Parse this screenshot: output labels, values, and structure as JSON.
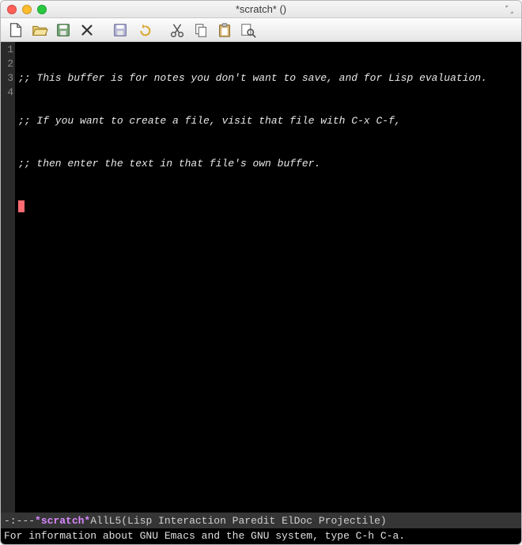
{
  "window": {
    "title": "*scratch* ()"
  },
  "toolbar": {
    "new_file": "new-file",
    "open_file": "open-file",
    "save_file": "save-file",
    "close": "close",
    "save_all": "save-all",
    "undo": "undo",
    "cut": "cut",
    "copy": "copy",
    "paste": "paste",
    "search": "search"
  },
  "gutter": {
    "lines": [
      "1",
      "2",
      "3",
      "4"
    ]
  },
  "buffer": {
    "lines": [
      ";; This buffer is for notes you don't want to save, and for Lisp evaluation.",
      ";; If you want to create a file, visit that file with C-x C-f,",
      ";; then enter the text in that file's own buffer.",
      ""
    ]
  },
  "modeline": {
    "flags": "-:---",
    "buffer_name": "*scratch*",
    "position": "All",
    "line": "L5",
    "modes": "(Lisp Interaction Paredit ElDoc Projectile)"
  },
  "echo_area": "For information about GNU Emacs and the GNU system, type C-h C-a."
}
